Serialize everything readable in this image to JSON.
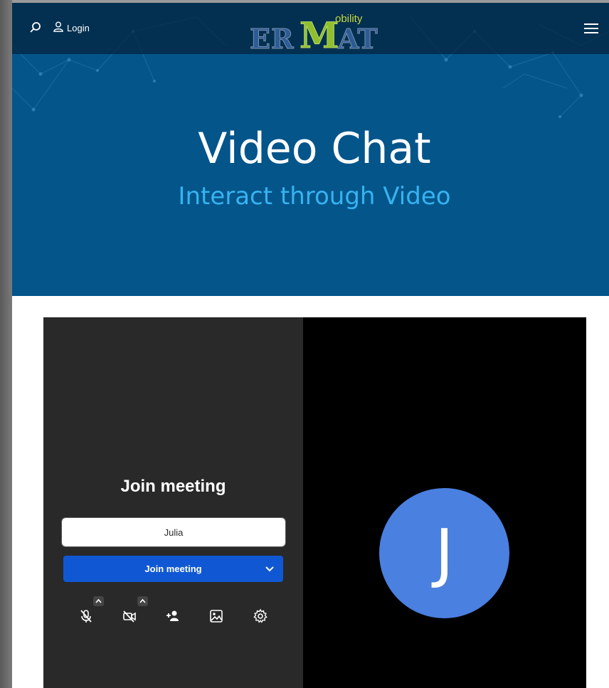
{
  "nav": {
    "login_label": "Login",
    "search_icon": "search-icon",
    "user_icon": "user-icon",
    "menu_icon": "hamburger-menu-icon",
    "logo": {
      "er": "ER",
      "m": "M",
      "at": "AT",
      "obility": "obility"
    }
  },
  "hero": {
    "title": "Video Chat",
    "subtitle": "Interact through Video",
    "background_color": "#03558a",
    "subtitle_color": "#37b3f0"
  },
  "prejoin": {
    "title": "Join meeting",
    "name_value": "Julia",
    "join_button_label": "Join meeting",
    "join_button_color": "#1058d3",
    "toolbar": [
      "microphone-muted-icon",
      "camera-off-icon",
      "invite-person-icon",
      "background-image-icon",
      "settings-gear-icon"
    ]
  },
  "participant": {
    "initial": "J",
    "avatar_color": "#4a80e0"
  }
}
